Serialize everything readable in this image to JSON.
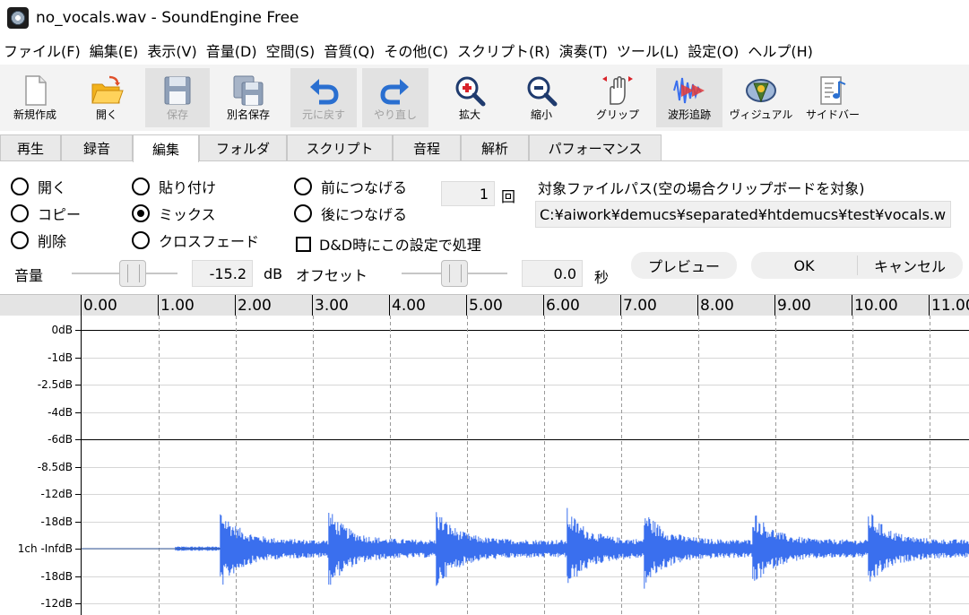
{
  "window": {
    "title": "no_vocals.wav - SoundEngine Free"
  },
  "menu": [
    "ファイル(F)",
    "編集(E)",
    "表示(V)",
    "音量(D)",
    "空間(S)",
    "音質(Q)",
    "その他(C)",
    "スクリプト(R)",
    "演奏(T)",
    "ツール(L)",
    "設定(O)",
    "ヘルプ(H)"
  ],
  "toolbar": [
    {
      "label": "新規作成",
      "icon": "new-file-icon",
      "enabled": true
    },
    {
      "label": "開く",
      "icon": "open-folder-icon",
      "enabled": true
    },
    {
      "label": "保存",
      "icon": "save-icon",
      "enabled": false
    },
    {
      "label": "別名保存",
      "icon": "save-as-icon",
      "enabled": true
    },
    {
      "label": "元に戻す",
      "icon": "undo-icon",
      "enabled": false
    },
    {
      "label": "やり直し",
      "icon": "redo-icon",
      "enabled": false
    },
    {
      "label": "拡大",
      "icon": "zoom-in-icon",
      "enabled": true
    },
    {
      "label": "縮小",
      "icon": "zoom-out-icon",
      "enabled": true
    },
    {
      "label": "グリップ",
      "icon": "grip-hand-icon",
      "enabled": true
    },
    {
      "label": "波形追跡",
      "icon": "waveform-follow-icon",
      "enabled": true,
      "active": true
    },
    {
      "label": "ヴィジュアル",
      "icon": "visual-icon",
      "enabled": true
    },
    {
      "label": "サイドバー",
      "icon": "sidebar-icon",
      "enabled": true
    }
  ],
  "tabs": {
    "items": [
      "再生",
      "録音",
      "編集",
      "フォルダ",
      "スクリプト",
      "音程",
      "解析",
      "パフォーマンス"
    ],
    "active": "編集"
  },
  "edit": {
    "radios": [
      {
        "label": "開く",
        "selected": false
      },
      {
        "label": "コピー",
        "selected": false
      },
      {
        "label": "削除",
        "selected": false
      },
      {
        "label": "貼り付け",
        "selected": false
      },
      {
        "label": "ミックス",
        "selected": true
      },
      {
        "label": "クロスフェード",
        "selected": false
      },
      {
        "label": "前につなげる",
        "selected": false
      },
      {
        "label": "後につなげる",
        "selected": false
      }
    ],
    "dnd_checkbox": {
      "label": "D&D時にこの設定で処理",
      "checked": false
    },
    "repeat": {
      "value": "1",
      "unit": "回"
    },
    "target_path": {
      "label": "対象ファイルパス(空の場合クリップボードを対象)",
      "value": "C:¥aiwork¥demucs¥separated¥htdemucs¥test¥vocals.w"
    },
    "volume": {
      "label": "音量",
      "value": "-15.2",
      "unit": "dB",
      "slider_fraction": 0.6
    },
    "offset": {
      "label": "オフセット",
      "value": "0.0",
      "unit": "秒",
      "slider_fraction": 0.5
    },
    "buttons": {
      "preview": "プレビュー",
      "ok": "OK",
      "cancel": "キャンセル"
    }
  },
  "timeline": {
    "ticks": [
      "0.00",
      "1.00",
      "2.00",
      "3.00",
      "4.00",
      "5.00",
      "6.00",
      "7.00",
      "8.00",
      "9.00",
      "10.00",
      "11.00"
    ]
  },
  "waveform": {
    "db_labels": [
      "0dB",
      "-1dB",
      "-2.5dB",
      "-4dB",
      "-6dB",
      "-8.5dB",
      "-12dB",
      "-18dB",
      "1ch -InfdB",
      "-18dB",
      "-12dB"
    ],
    "solid_gridlines_db": [
      "0dB",
      "-6dB"
    ],
    "color": "#3a6fee",
    "signal_start_seconds": 1.8,
    "onsets_seconds": [
      1.8,
      3.2,
      4.6,
      6.3,
      7.3,
      8.7,
      10.2
    ]
  },
  "colors": {
    "toolbar_bg": "#f3f3f3",
    "ruler_bg": "#e4e4e4",
    "tab_bg": "#e9e9e9",
    "wave": "#3a6fee"
  }
}
